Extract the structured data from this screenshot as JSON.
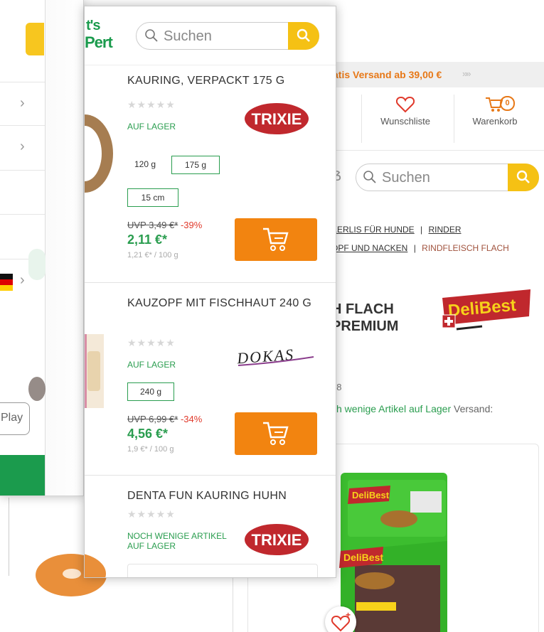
{
  "back_page": {
    "promo_text": "atis Versand ab 39,00 €",
    "promo_arrows": "»»",
    "nav_partial": "n",
    "wishlist_label": "Wunschliste",
    "cart_label": "Warenkorb",
    "cart_count": "0",
    "search_placeholder": "Suchen",
    "breadcrumb": {
      "row1_a": "KERLIS FÜR HUNDE",
      "row1_b": "RINDER",
      "row2_a": "OPF UND NACKEN",
      "row2_current": "RINDFLEISCH FLACH",
      "separator": "|"
    },
    "product_title_line1": "H FLACH",
    "product_title_line2": "PREMIUM",
    "partial_b": "ẞ",
    "brand_logo_text": "DeliBest",
    "article_no": "78",
    "stock_text": "ch wenige Artikel auf Lager",
    "shipping_text": "Versand:"
  },
  "menu_panel": {
    "play_label": "Play"
  },
  "front": {
    "logo_line1": "t's",
    "logo_line2": "Pert",
    "search_placeholder": "Suchen",
    "items": [
      {
        "name": "KAURING, VERPACKT 175 G",
        "stars": "★★★★★",
        "stock": "AUF LAGER",
        "brand": "TRIXIE",
        "variants": [
          "120 g",
          "175 g",
          "15 cm"
        ],
        "uvp": "UVP 3,49 €*",
        "discount": "-39%",
        "price": "2,11 €*",
        "unit_price": "1,21 €* / 100 g"
      },
      {
        "name": "KAUZOPF MIT FISCHHAUT 240 G",
        "stars": "★★★★★",
        "stock": "AUF LAGER",
        "brand": "DOKAS",
        "variants": [
          "240 g"
        ],
        "uvp": "UVP 6,99 €*",
        "discount": "-34%",
        "price": "4,56 €*",
        "unit_price": "1,9 €* / 100 g"
      },
      {
        "name": "DENTA FUN KAURING HUHN",
        "stars": "★★★★★",
        "stock_line1": "NOCH WENIGE ARTIKEL",
        "stock_line2": "AUF LAGER",
        "brand": "TRIXIE"
      }
    ]
  },
  "colors": {
    "green": "#2a9d4f",
    "orange": "#f28410",
    "yellow": "#f5c114",
    "red": "#e0392b",
    "trixie_red": "#c0282d"
  }
}
